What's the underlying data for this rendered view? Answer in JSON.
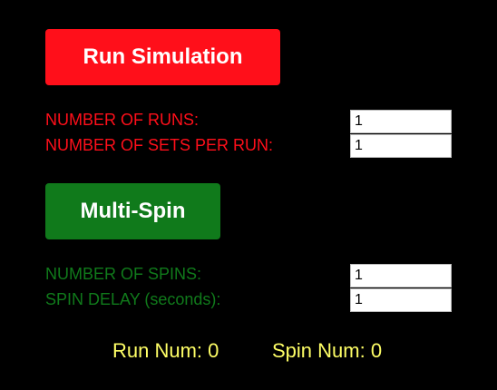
{
  "colors": {
    "background": "#000000",
    "run_accent": "#ff0f1a",
    "spin_accent": "#107a1b",
    "counter_text": "#ffff66"
  },
  "simulation": {
    "run_button_label": "Run Simulation",
    "runs_label": "NUMBER OF RUNS:",
    "runs_value": "1",
    "sets_label": "NUMBER OF SETS PER RUN:",
    "sets_value": "1"
  },
  "multispin": {
    "button_label": "Multi-Spin",
    "spins_label": "NUMBER OF SPINS:",
    "spins_value": "1",
    "delay_label": "SPIN DELAY (seconds):",
    "delay_value": "1"
  },
  "status": {
    "run_num": "Run Num: 0",
    "spin_num": "Spin Num: 0"
  }
}
